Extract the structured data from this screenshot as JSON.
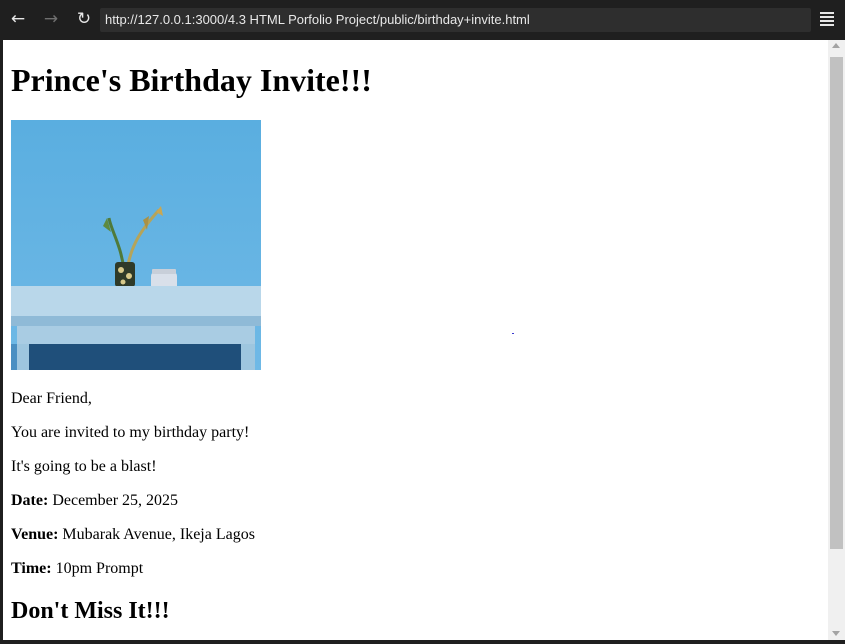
{
  "browser": {
    "back_icon": "←",
    "forward_icon": "→",
    "reload_icon": "↻",
    "url": "http://127.0.0.1:3000/4.3 HTML Porfolio Project/public/birthday+invite.html"
  },
  "page": {
    "heading": "Prince's Birthday Invite!!!",
    "image_description": "light blue table with small plant and candle jar against blue wall",
    "greeting": "Dear Friend,",
    "invite_text": "You are invited to my birthday party!",
    "blast_text": "It's going to be a blast!",
    "date_label": "Date:",
    "date_value": "December 25, 2025",
    "venue_label": "Venue:",
    "venue_value": "Mubarak Avenue, Ikeja Lagos",
    "time_label": "Time:",
    "time_value": "10pm Prompt",
    "closing_heading": "Don't Miss It!!!"
  },
  "colors": {
    "chrome_bg": "#1f1f1f",
    "urlbar_bg": "#2e2e2e",
    "page_bg": "#ffffff",
    "scrollbar_thumb": "#c1c1c1"
  }
}
